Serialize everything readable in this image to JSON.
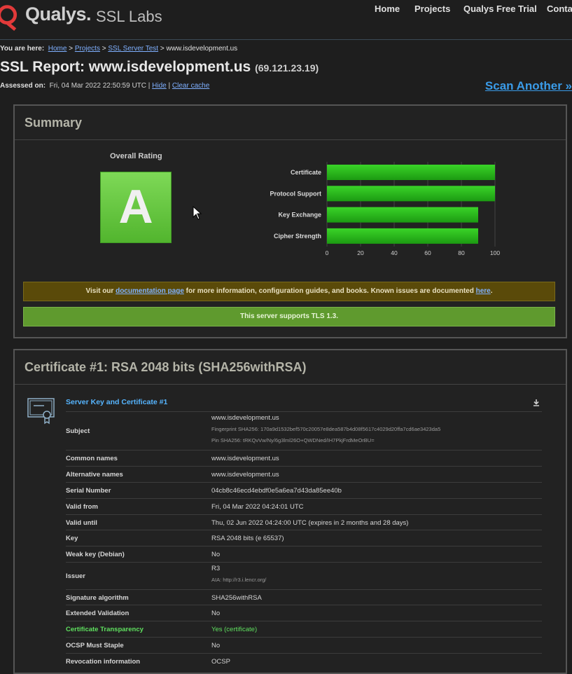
{
  "header": {
    "brand": "Qualys.",
    "product": "SSL Labs",
    "nav": [
      "Home",
      "Projects",
      "Qualys Free Trial",
      "Contact"
    ]
  },
  "breadcrumb": {
    "prefix": "You are here:",
    "links": [
      "Home",
      "Projects",
      "SSL Server Test"
    ],
    "separator": ">",
    "current": "www.isdevelopment.us"
  },
  "report": {
    "title": "SSL Report: www.isdevelopment.us",
    "ip": "(69.121.23.19)",
    "assessed_label": "Assessed on:",
    "assessed_value": "Fri, 04 Mar 2022 22:50:59 UTC",
    "hide_link": "Hide",
    "clear_cache_link": "Clear cache",
    "scan_another": "Scan Another »"
  },
  "summary": {
    "heading": "Summary",
    "overall_label": "Overall Rating",
    "grade": "A",
    "doc_notice": {
      "pre": "Visit our",
      "link": "documentation page",
      "mid": "for more information, configuration guides, and books. Known issues are documented",
      "link2": "here",
      "post": "."
    },
    "tls_notice": "This server supports TLS 1.3."
  },
  "chart_data": {
    "type": "bar",
    "orientation": "horizontal",
    "categories": [
      "Certificate",
      "Protocol Support",
      "Key Exchange",
      "Cipher Strength"
    ],
    "values": [
      100,
      100,
      90,
      90
    ],
    "xlim": [
      0,
      100
    ],
    "xticks": [
      0,
      20,
      40,
      60,
      80,
      100
    ],
    "color": "#2fbf1e",
    "grid": true
  },
  "certificate": {
    "heading": "Certificate #1: RSA 2048 bits (SHA256withRSA)",
    "section_title": "Server Key and Certificate #1",
    "rows": [
      {
        "key": "Subject",
        "value": "www.isdevelopment.us",
        "sub": [
          "Fingerprint SHA256: 170a9d1532bef570c20057e8dea587b4d08f5617c4029d20ffa7cd6ae3423da5",
          "Pin SHA256: tRKQvVw/Ny/6g3lml26O+QWDNed/IH7PkjFrdMeOrBU="
        ]
      },
      {
        "key": "Common names",
        "value": "www.isdevelopment.us"
      },
      {
        "key": "Alternative names",
        "value": "www.isdevelopment.us"
      },
      {
        "key": "Serial Number",
        "value": "04cb8c46ecd4ebdf0e5a6ea7d43da85ee40b"
      },
      {
        "key": "Valid from",
        "value": "Fri, 04 Mar 2022 04:24:01 UTC"
      },
      {
        "key": "Valid until",
        "value": "Thu, 02 Jun 2022 04:24:00 UTC (expires in 2 months and 28 days)"
      },
      {
        "key": "Key",
        "value": "RSA 2048 bits (e 65537)"
      },
      {
        "key": "Weak key (Debian)",
        "value": "No"
      },
      {
        "key": "Issuer",
        "value": "R3",
        "sub": [
          "AIA: http://r3.i.lencr.org/"
        ]
      },
      {
        "key": "Signature algorithm",
        "value": "SHA256withRSA"
      },
      {
        "key": "Extended Validation",
        "value": "No"
      },
      {
        "key": "Certificate Transparency",
        "value": "Yes (certificate)",
        "highlight": true
      },
      {
        "key": "OCSP Must Staple",
        "value": "No"
      },
      {
        "key": "Revocation information",
        "value": "OCSP"
      }
    ]
  }
}
